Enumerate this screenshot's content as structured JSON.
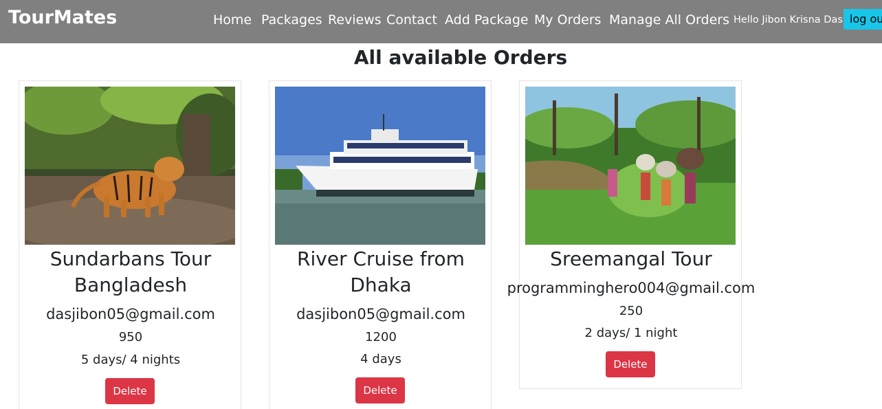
{
  "navbar": {
    "brand": "TourMates",
    "links": [
      "Home",
      "Packages",
      "Reviews",
      "Contact",
      "Add Package",
      "My Orders",
      "Manage All Orders"
    ],
    "greeting": "Hello Jibon Krisna Das",
    "logout_label": "log out",
    "colors": {
      "background": "#808080",
      "logout": "#17c6e8"
    }
  },
  "page": {
    "title": "All available Orders"
  },
  "orders": [
    {
      "name_line1": "Sundarbans Tour",
      "name_line2": "Bangladesh",
      "email": "dasjibon05@gmail.com",
      "price": "950",
      "duration": "5 days/ 4 nights",
      "delete_label": "Delete",
      "image": "tiger-photo"
    },
    {
      "name_line1": "River Cruise from",
      "name_line2": "Dhaka",
      "email": "dasjibon05@gmail.com",
      "price": "1200",
      "duration": "4 days",
      "delete_label": "Delete",
      "image": "cruise-ship-photo"
    },
    {
      "name_line1": "Sreemangal Tour",
      "email": "programminghero004@gmail.com",
      "price": "250",
      "duration": "2 days/ 1 night",
      "delete_label": "Delete",
      "image": "tea-garden-photo"
    }
  ],
  "colors": {
    "delete_button": "#dc3545"
  }
}
